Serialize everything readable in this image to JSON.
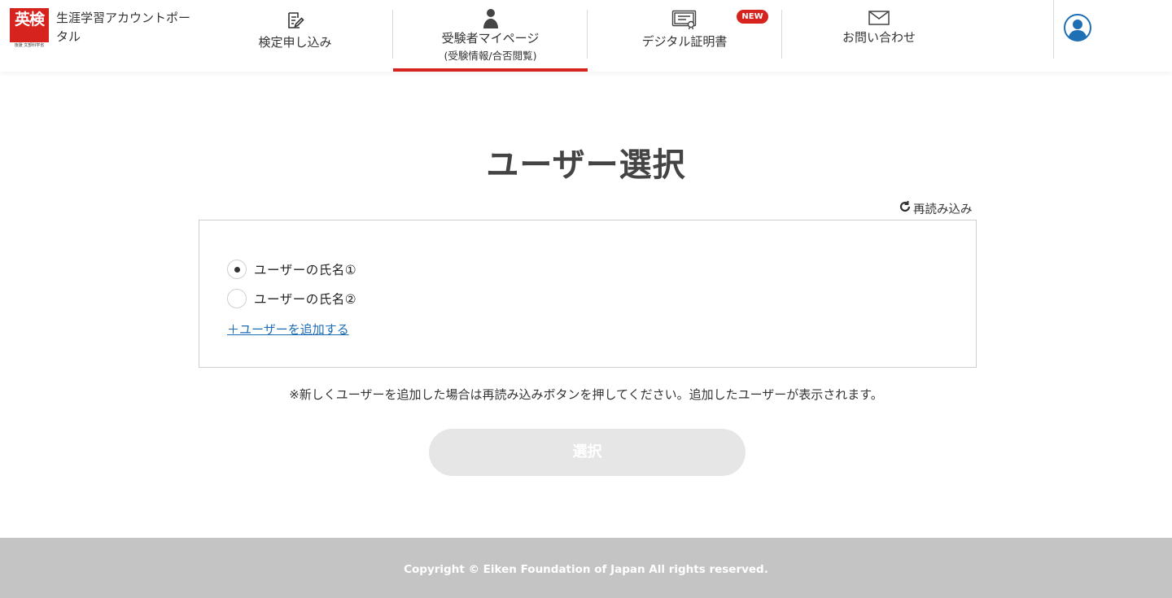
{
  "header": {
    "logo": {
      "main_text": "英検",
      "sub_text": "後援 文部科学省"
    },
    "portal_title": "生涯学習アカウントポータル",
    "nav": [
      {
        "label": "検定申し込み",
        "icon": "edit-icon"
      },
      {
        "label": "受験者マイページ",
        "sublabel": "(受験情報/合否閲覧)",
        "icon": "person-icon",
        "active": true
      },
      {
        "label": "デジタル証明書",
        "icon": "certificate-icon",
        "badge": "NEW"
      },
      {
        "label": "お問い合わせ",
        "icon": "mail-icon"
      }
    ],
    "avatar_icon": "user-avatar-icon"
  },
  "main": {
    "title": "ユーザー選択",
    "reload_label": "再読み込み",
    "users": [
      {
        "label": "ユーザーの氏名①",
        "checked": true
      },
      {
        "label": "ユーザーの氏名②",
        "checked": false
      }
    ],
    "add_user_label": "＋ユーザーを追加する",
    "notice": "※新しくユーザーを追加した場合は再読み込みボタンを押してください。追加したユーザーが表示されます。",
    "select_button_label": "選択"
  },
  "footer": {
    "copyright": "Copyright © Eiken Foundation of Japan All rights reserved."
  },
  "colors": {
    "brand_red": "#d7231e",
    "link_blue": "#1c6cb6",
    "avatar_blue": "#1f6fb5",
    "disabled_button": "#e6e6e6",
    "footer_gray": "#c4c4c4"
  }
}
